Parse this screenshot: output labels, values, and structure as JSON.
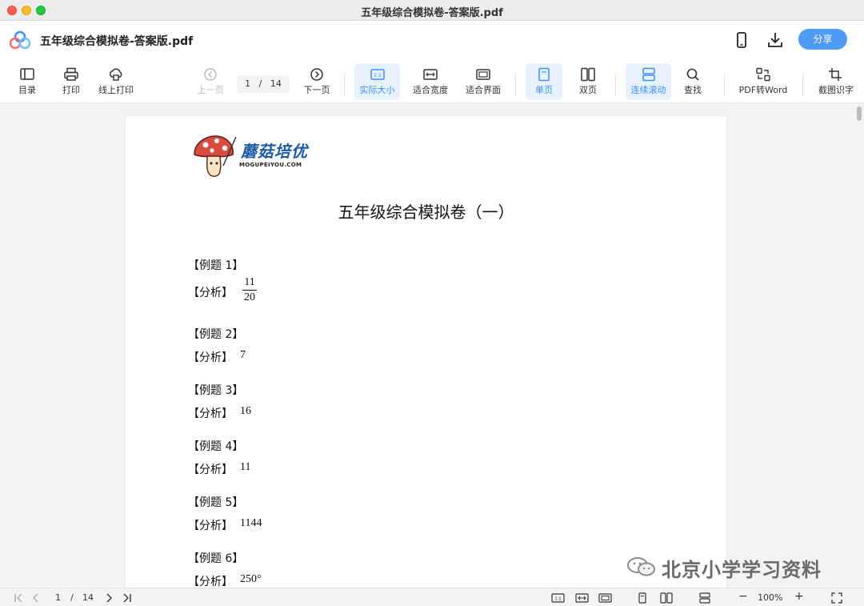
{
  "window": {
    "title": "五年级综合模拟卷-答案版.pdf"
  },
  "app_header": {
    "doc_name": "五年级综合模拟卷-答案版.pdf",
    "share_label": "分享"
  },
  "toolbar": {
    "toc": "目录",
    "print": "打印",
    "online_print": "线上打印",
    "prev_page": "上一页",
    "current_page": "1",
    "page_separator": "/",
    "total_pages": "14",
    "next_page": "下一页",
    "actual_size": "实际大小",
    "fit_width": "适合宽度",
    "fit_screen": "适合界面",
    "single_page": "单页",
    "double_page": "双页",
    "continuous_scroll": "连续滚动",
    "find": "查找",
    "pdf_to_word": "PDF转Word",
    "screenshot_ocr": "截图识字",
    "accent_color": "#3d8ef5"
  },
  "document": {
    "brand_cn": "蘑菇培优",
    "brand_en": "MOGUPEIYOU.COM",
    "title": "五年级综合模拟卷（一）",
    "examples": [
      {
        "question": "【例题 1】",
        "analysis_label": "【分析】",
        "answer_numerator": "11",
        "answer_denominator": "20"
      },
      {
        "question": "【例题 2】",
        "analysis_label": "【分析】",
        "answer": "7"
      },
      {
        "question": "【例题 3】",
        "analysis_label": "【分析】",
        "answer": "16"
      },
      {
        "question": "【例题 4】",
        "analysis_label": "【分析】",
        "answer": "11"
      },
      {
        "question": "【例题 5】",
        "analysis_label": "【分析】",
        "answer": "1144"
      },
      {
        "question": "【例题 6】",
        "analysis_label": "【分析】",
        "answer": "250°"
      }
    ]
  },
  "watermark": {
    "text": "北京小学学习资料"
  },
  "statusbar": {
    "current_page": "1",
    "page_separator": "/",
    "total_pages": "14",
    "zoom": "100%",
    "minus": "−",
    "plus": "+"
  }
}
